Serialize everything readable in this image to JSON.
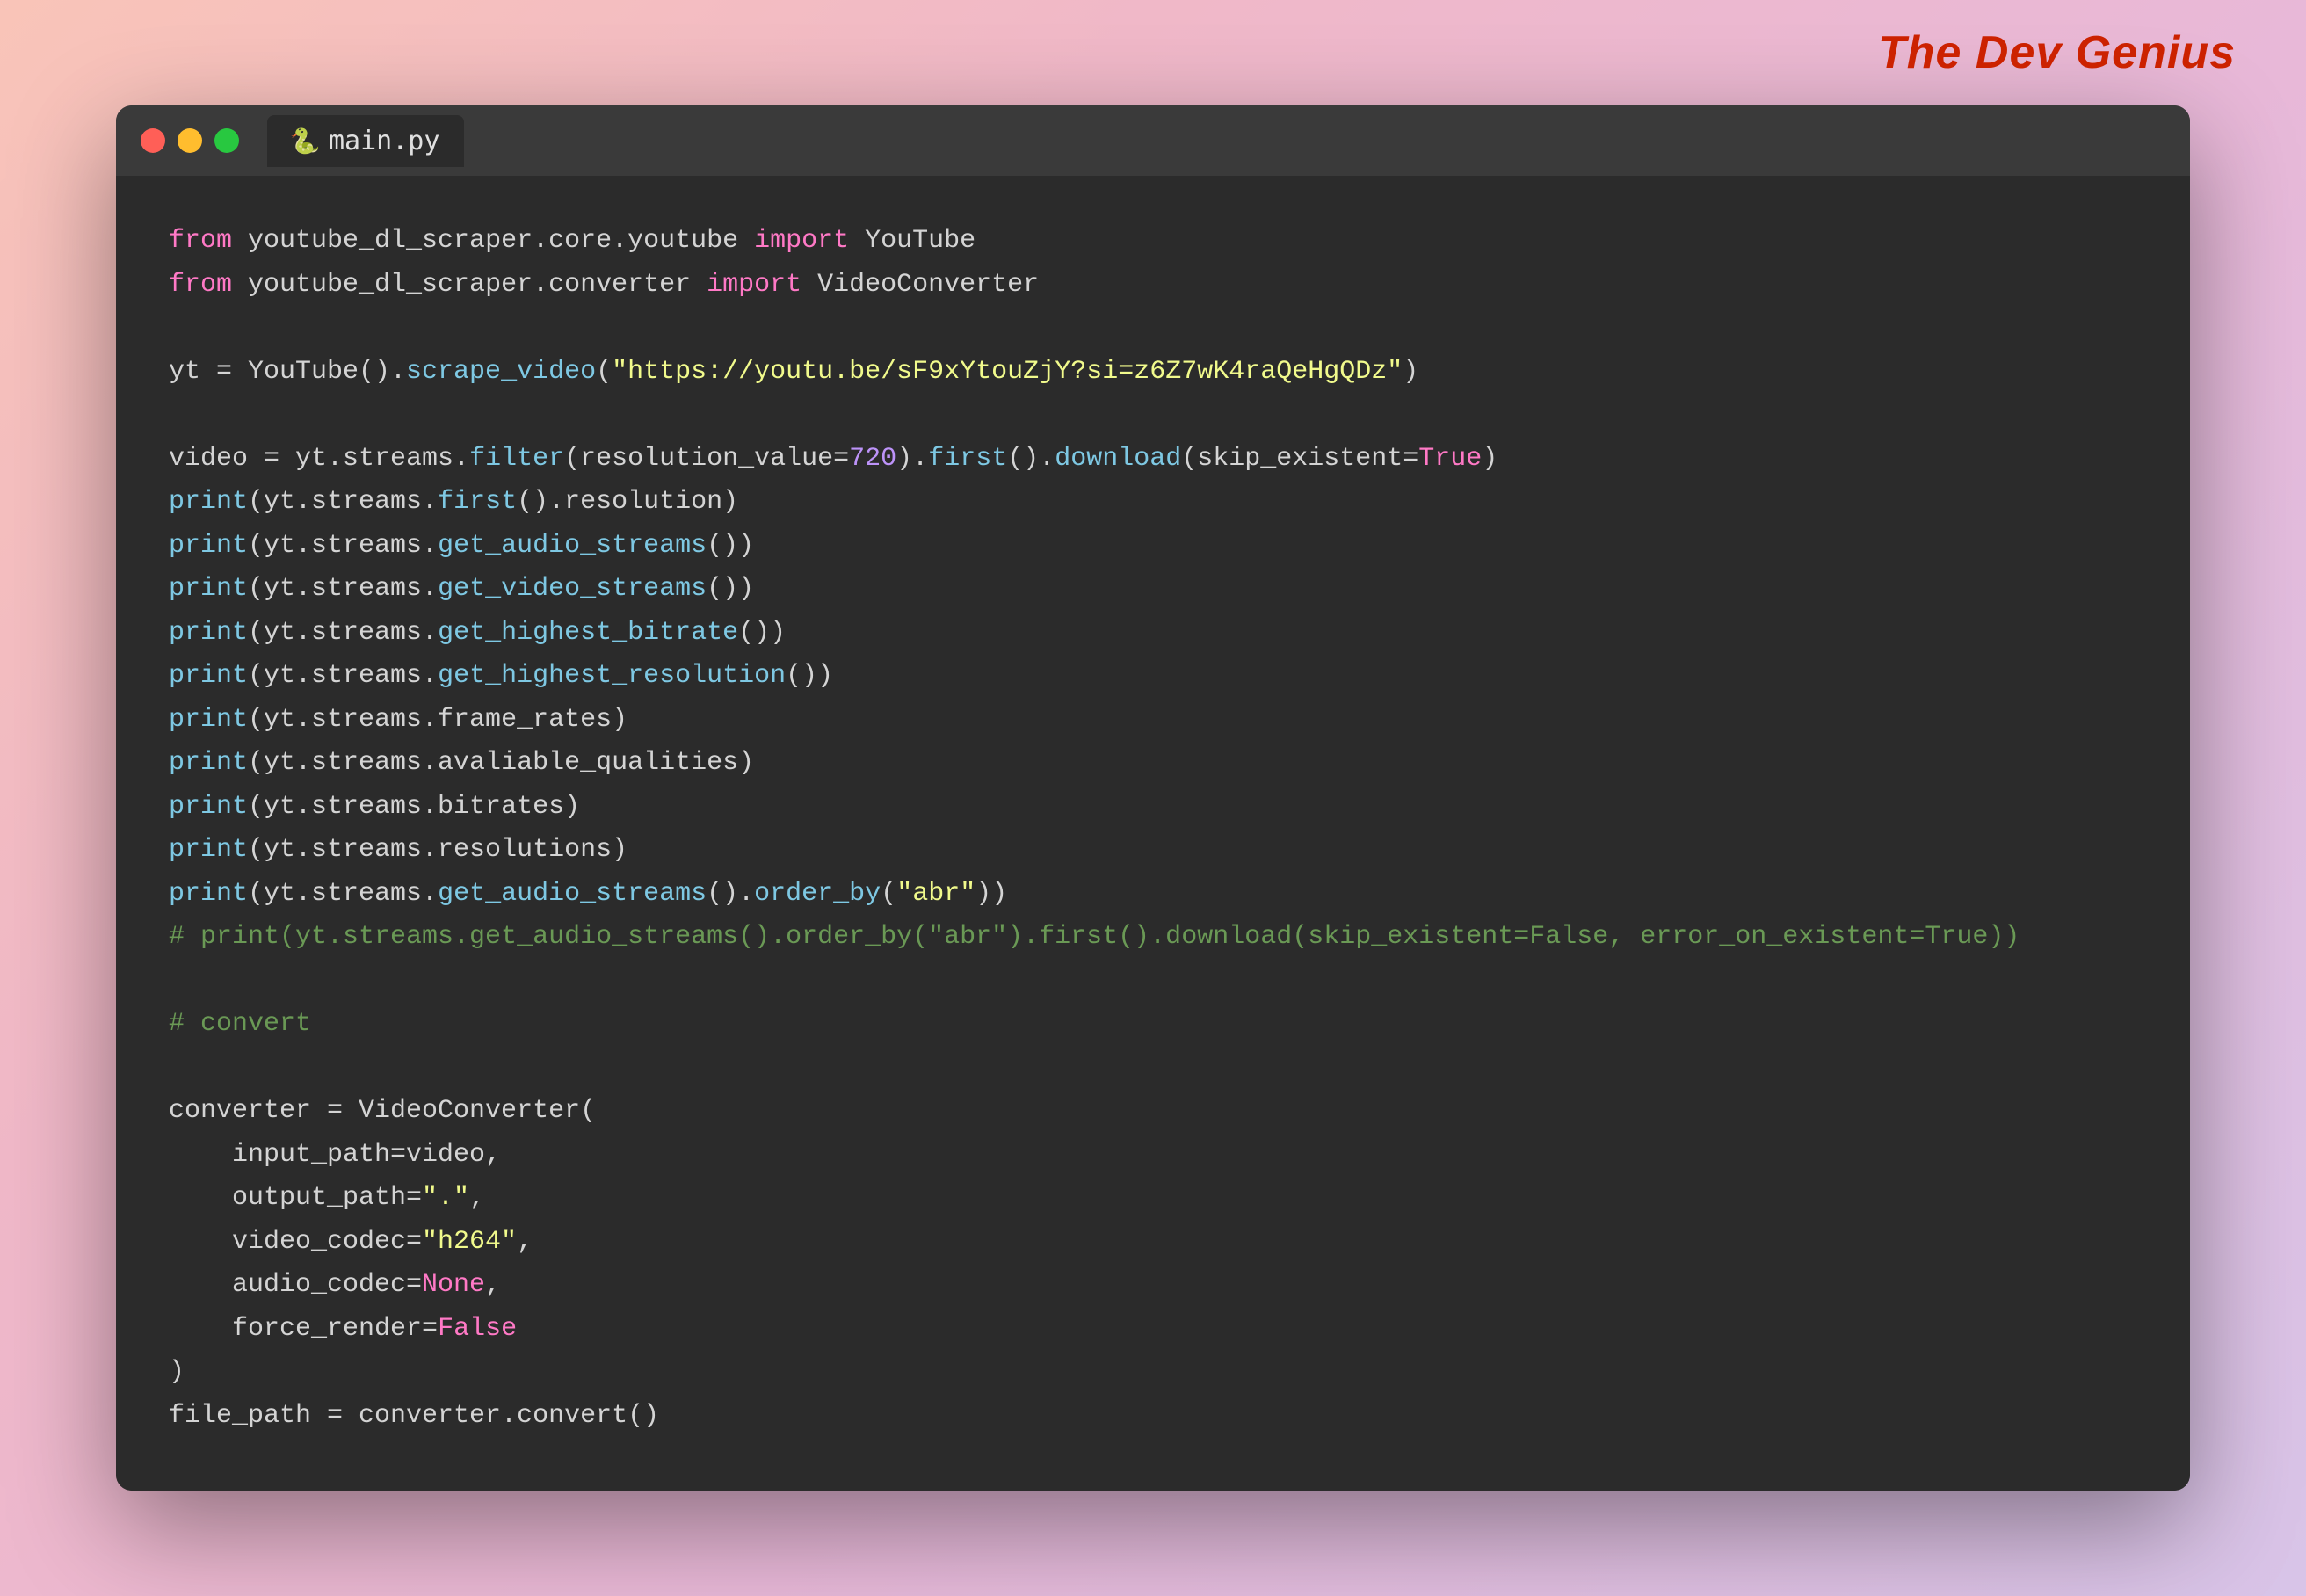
{
  "brand": {
    "label": "The Dev Genius"
  },
  "window": {
    "tab_name": "main.py"
  },
  "code": {
    "lines": [
      {
        "id": 1,
        "content": "from youtube_dl_scraper.core.youtube import YouTube"
      },
      {
        "id": 2,
        "content": "from youtube_dl_scraper.converter import VideoConverter"
      },
      {
        "id": 3,
        "content": ""
      },
      {
        "id": 4,
        "content": "yt = YouTube().scrape_video(\"https://youtu.be/sF9xYtouZjY?si=z6Z7wK4raQeHgQDz\")"
      },
      {
        "id": 5,
        "content": ""
      },
      {
        "id": 6,
        "content": "video = yt.streams.filter(resolution_value=720).first().download(skip_existent=True)"
      },
      {
        "id": 7,
        "content": "print(yt.streams.first().resolution)"
      },
      {
        "id": 8,
        "content": "print(yt.streams.get_audio_streams())"
      },
      {
        "id": 9,
        "content": "print(yt.streams.get_video_streams())"
      },
      {
        "id": 10,
        "content": "print(yt.streams.get_highest_bitrate())"
      },
      {
        "id": 11,
        "content": "print(yt.streams.get_highest_resolution())"
      },
      {
        "id": 12,
        "content": "print(yt.streams.frame_rates)"
      },
      {
        "id": 13,
        "content": "print(yt.streams.avaliable_qualities)"
      },
      {
        "id": 14,
        "content": "print(yt.streams.bitrates)"
      },
      {
        "id": 15,
        "content": "print(yt.streams.resolutions)"
      },
      {
        "id": 16,
        "content": "print(yt.streams.get_audio_streams().order_by(\"abr\"))"
      },
      {
        "id": 17,
        "content": "# print(yt.streams.get_audio_streams().order_by(\"abr\").first().download(skip_existent=False, error_on_existent=True))"
      },
      {
        "id": 18,
        "content": ""
      },
      {
        "id": 19,
        "content": "# convert"
      },
      {
        "id": 20,
        "content": ""
      },
      {
        "id": 21,
        "content": "converter = VideoConverter("
      },
      {
        "id": 22,
        "content": "    input_path=video,"
      },
      {
        "id": 23,
        "content": "    output_path=\".\","
      },
      {
        "id": 24,
        "content": "    video_codec=\"h264\","
      },
      {
        "id": 25,
        "content": "    audio_codec=None,"
      },
      {
        "id": 26,
        "content": "    force_render=False"
      },
      {
        "id": 27,
        "content": ")"
      },
      {
        "id": 28,
        "content": "file_path = converter.convert()"
      }
    ]
  }
}
